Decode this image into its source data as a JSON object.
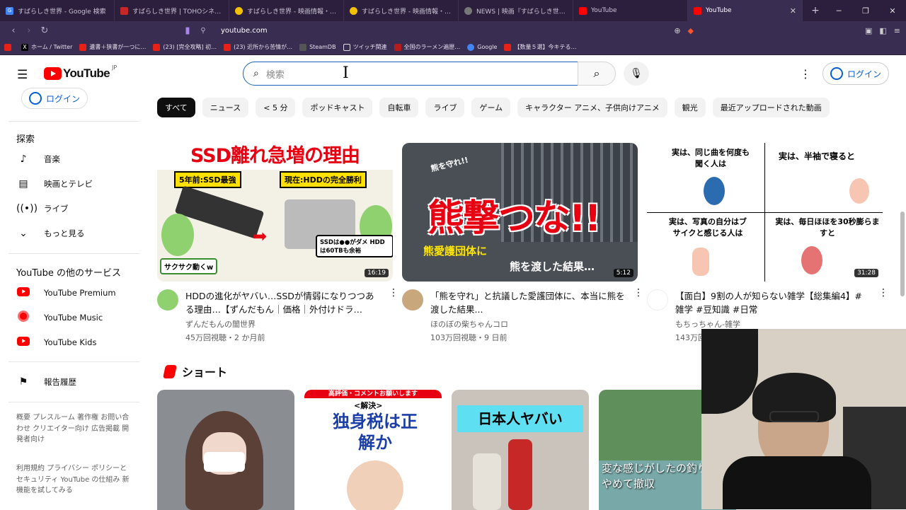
{
  "browser": {
    "tabs": [
      {
        "label": "すばらしき世界 - Google 検索",
        "color": "#4285f4",
        "glyph": "G"
      },
      {
        "label": "すばらしき世界 | TOHOシネマズ",
        "color": "#c62828",
        "glyph": ""
      },
      {
        "label": "すばらしき世界 - 映画情報・レビュー・評価",
        "color": "#f2c100",
        "glyph": ""
      },
      {
        "label": "すばらしき世界 - 映画情報・レビュー・評価",
        "color": "#f2c100",
        "glyph": ""
      },
      {
        "label": "NEWS | 映画『すばらしき世界』オフィシャル",
        "color": "#777777",
        "glyph": ""
      },
      {
        "label": "YouTube",
        "color": "#ff0000",
        "glyph": ""
      },
      {
        "label": "YouTube",
        "color": "#ff0000",
        "glyph": "",
        "active": true
      }
    ],
    "url": "youtube.com",
    "bookmarks": [
      "ホーム / Twitter",
      "遺書＋狭書が一つに…",
      "(23) [完全攻略] 初…",
      "(23) 近所から苦情が…",
      "SteamDB",
      "ツイッチ関連",
      "全国のラーメン遍歴…",
      "Google",
      "【数量５選】今キテる…"
    ]
  },
  "header": {
    "logo_text": "YouTube",
    "region": "JP",
    "search_placeholder": "検索",
    "login_label": "ログイン"
  },
  "sidebar": {
    "login_label": "ログイン",
    "explore_heading": "探索",
    "explore_items": [
      {
        "label": "音楽",
        "icon": "music-note-icon"
      },
      {
        "label": "映画とテレビ",
        "icon": "film-icon"
      },
      {
        "label": "ライブ",
        "icon": "live-icon"
      },
      {
        "label": "もっと見る",
        "icon": "chevron-down-icon"
      }
    ],
    "other_heading": "YouTube の他のサービス",
    "other_items": [
      {
        "label": "YouTube Premium",
        "color": "#ff0000"
      },
      {
        "label": "YouTube Music",
        "color": "#ff0000"
      },
      {
        "label": "YouTube Kids",
        "color": "#ff0000"
      }
    ],
    "report_label": "報告履歴",
    "footer1": "概要 プレスルーム 著作権 お問い合わせ クリエイター向け 広告掲載 開発者向け",
    "footer2": "利用規約 プライバシー ポリシーとセキュリティ YouTube の仕組み 新機能を試してみる"
  },
  "chips": [
    "すべて",
    "ニュース",
    "< 5 分",
    "ポッドキャスト",
    "自転車",
    "ライブ",
    "ゲーム",
    "キャラクター アニメ、子供向けアニメ",
    "観光",
    "最近アップロードされた動画"
  ],
  "videos": [
    {
      "title": "HDDの進化がヤバい…SSDが情弱になりつつある理由…【ずんだもん｜価格｜外付けドラ…",
      "channel": "ずんだもんの闇世界",
      "meta": "45万回視聴・2 か月前",
      "duration": "16:19",
      "thumb_text1": "SSD離れ急増の理由",
      "thumb_text2": "5年前:SSD最強",
      "thumb_text3": "現在:HDDの完全勝利",
      "thumb_text4": "サクサク動くw",
      "thumb_text5": "SSDは●●がダメ HDDは60TBも余裕"
    },
    {
      "title": "「熊を守れ」と抗議した愛護団体に、本当に熊を渡した結果...",
      "channel": "ほのぼの柴ちゃんコロ",
      "meta": "103万回視聴・9 日前",
      "duration": "5:12",
      "thumb_text1": "熊撃つな!!",
      "thumb_text2": "熊愛護団体に",
      "thumb_text3": "熊を渡した結果…",
      "thumb_text4": "熊を守れ!!"
    },
    {
      "title": "【面白】9割の人が知らない雑学【総集編4】#雑学 #豆知識 #日常",
      "channel": "もちっちゃん-雑学",
      "meta": "143万回",
      "duration": "31:28",
      "thumb_text1": "実は、同じ曲を何度も聞く人は",
      "thumb_text2": "実は、半袖で寝ると",
      "thumb_text3": "実は、写真の自分はブサイクと感じる人は",
      "thumb_text4": "実は、毎日ほほを30秒膨らますと"
    }
  ],
  "shorts": {
    "heading": "ショート",
    "items": [
      {
        "text": ""
      },
      {
        "text": "独身税は正解か",
        "top": "高評価・コメントお願いします",
        "tag": "<解決>"
      },
      {
        "text": "日本人ヤバい"
      },
      {
        "text": "変な感じがしたの釣りやめて撤収"
      }
    ]
  }
}
